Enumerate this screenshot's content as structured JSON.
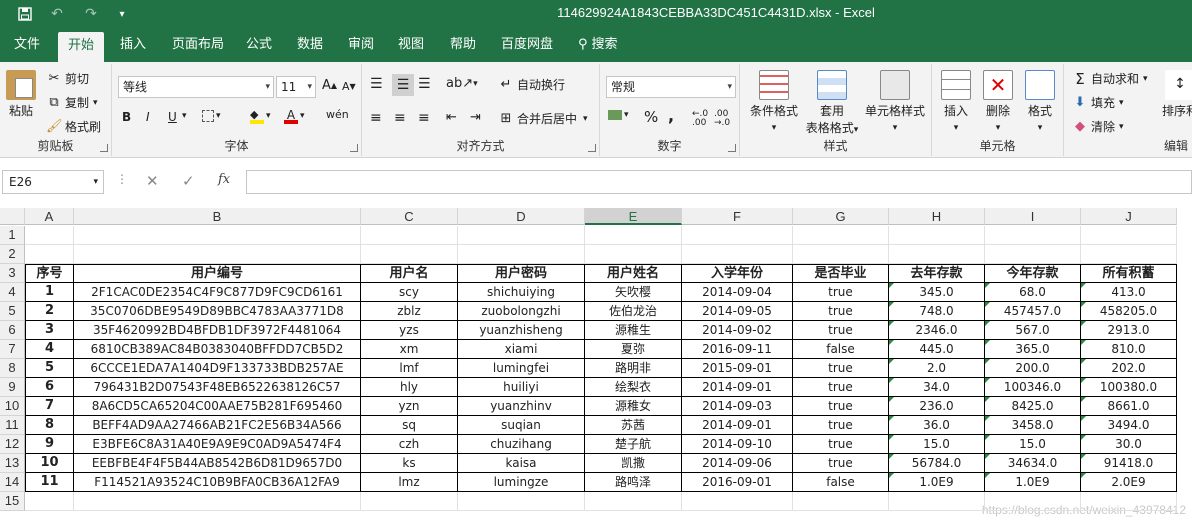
{
  "titlebar": {
    "title": "114629924A1843CEBBA33DC451C4431D.xlsx  -  Excel",
    "save_icon": "save-icon",
    "undo_icon": "undo-icon",
    "redo_icon": "redo-icon",
    "customize_icon": "chevron-down-icon"
  },
  "tabs": [
    "文件",
    "开始",
    "插入",
    "页面布局",
    "公式",
    "数据",
    "审阅",
    "视图",
    "帮助",
    "百度网盘"
  ],
  "tab_active": "开始",
  "search_label": "搜索",
  "ribbon": {
    "clipboard": {
      "label": "剪贴板",
      "paste": "粘贴",
      "cut": "剪切",
      "copy": "复制",
      "format_painter": "格式刷"
    },
    "font": {
      "label": "字体",
      "font_name": "等线",
      "font_size": "11",
      "bold": "B",
      "italic": "I",
      "underline": "U",
      "wen": "wén"
    },
    "alignment": {
      "label": "对齐方式",
      "wrap": "自动换行",
      "merge": "合并后居中"
    },
    "number": {
      "label": "数字",
      "format": "常规",
      "percent": "%",
      "comma": ","
    },
    "styles": {
      "label": "样式",
      "conditional": "条件格式",
      "table1": "套用",
      "table2": "表格格式",
      "cell_styles": "单元格样式"
    },
    "cells": {
      "label": "单元格",
      "insert": "插入",
      "delete": "删除",
      "format": "格式"
    },
    "editing": {
      "label": "编辑",
      "autosum": "自动求和",
      "fill": "填充",
      "clear": "清除",
      "sort": "排序和"
    }
  },
  "formula_bar": {
    "name_box": "E26",
    "fx": "fx",
    "value": ""
  },
  "columns": [
    "A",
    "B",
    "C",
    "D",
    "E",
    "F",
    "G",
    "H",
    "I",
    "J"
  ],
  "selected_column": "E",
  "rows": [
    "1",
    "2",
    "3",
    "4",
    "5",
    "6",
    "7",
    "8",
    "9",
    "10",
    "11",
    "12",
    "13",
    "14",
    "15"
  ],
  "table": {
    "headers": [
      "序号",
      "用户编号",
      "用户名",
      "用户密码",
      "用户姓名",
      "入学年份",
      "是否毕业",
      "去年存款",
      "今年存款",
      "所有积蓄"
    ],
    "data": [
      [
        "1",
        "2F1CAC0DE2354C4F9C877D9FC9CD6161",
        "scy",
        "shichuiying",
        "矢吹樱",
        "2014-09-04",
        "true",
        "345.0",
        "68.0",
        "413.0"
      ],
      [
        "2",
        "35C0706DBE9549D89BBC4783AA3771D8",
        "zblz",
        "zuobolongzhi",
        "佐伯龙治",
        "2014-09-05",
        "true",
        "748.0",
        "457457.0",
        "458205.0"
      ],
      [
        "3",
        "35F4620992BD4BFDB1DF3972F4481064",
        "yzs",
        "yuanzhisheng",
        "源稚生",
        "2014-09-02",
        "true",
        "2346.0",
        "567.0",
        "2913.0"
      ],
      [
        "4",
        "6810CB389AC84B0383040BFFDD7CB5D2",
        "xm",
        "xiami",
        "夏弥",
        "2016-09-11",
        "false",
        "445.0",
        "365.0",
        "810.0"
      ],
      [
        "5",
        "6CCCE1EDA7A1404D9F133733BDB257AE",
        "lmf",
        "lumingfei",
        "路明非",
        "2015-09-01",
        "true",
        "2.0",
        "200.0",
        "202.0"
      ],
      [
        "6",
        "796431B2D07543F48EB6522638126C57",
        "hly",
        "huiliyi",
        "绘梨衣",
        "2014-09-01",
        "true",
        "34.0",
        "100346.0",
        "100380.0"
      ],
      [
        "7",
        "8A6CD5CA65204C00AAE75B281F695460",
        "yzn",
        "yuanzhinv",
        "源稚女",
        "2014-09-03",
        "true",
        "236.0",
        "8425.0",
        "8661.0"
      ],
      [
        "8",
        "BEFF4AD9AA27466AB21FC2E56B34A566",
        "sq",
        "suqian",
        "苏茜",
        "2014-09-01",
        "true",
        "36.0",
        "3458.0",
        "3494.0"
      ],
      [
        "9",
        "E3BFE6C8A31A40E9A9E9C0AD9A5474F4",
        "czh",
        "chuzihang",
        "楚子航",
        "2014-09-10",
        "true",
        "15.0",
        "15.0",
        "30.0"
      ],
      [
        "10",
        "EEBFBE4F4F5B44AB8542B6D81D9657D0",
        "ks",
        "kaisa",
        "凯撒",
        "2014-09-06",
        "true",
        "56784.0",
        "34634.0",
        "91418.0"
      ],
      [
        "11",
        "F114521A93524C10B9BFA0CB36A12FA9",
        "lmz",
        "lumingze",
        "路鸣泽",
        "2016-09-01",
        "false",
        "1.0E9",
        "1.0E9",
        "2.0E9"
      ]
    ]
  },
  "watermark": "https://blog.csdn.net/weixin_43978412",
  "colors": {
    "accent": "#217346",
    "header_bg": "#f0f0f0"
  }
}
